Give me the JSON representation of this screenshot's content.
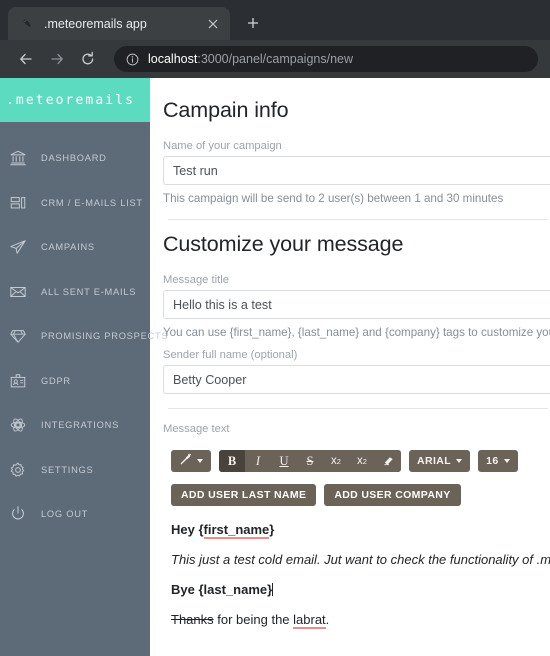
{
  "browser": {
    "tab": {
      "title": ".meteoremails app",
      "favicon_icon": "rocket-icon",
      "close_icon": "close-icon"
    },
    "new_tab_label": "+",
    "back_icon": "back-arrow-icon",
    "forward_icon": "forward-arrow-icon",
    "reload_icon": "reload-icon",
    "site_info_icon": "info-circle-icon",
    "url_host": "localhost",
    "url_path": ":3000/panel/campaigns/new"
  },
  "sidebar": {
    "brand": ".meteoremails",
    "brand_color": "#5cdbc0",
    "bg_color": "#5d6b78",
    "items": [
      {
        "label": "DASHBOARD",
        "icon": "bank-icon"
      },
      {
        "label": "CRM / E-MAILS LIST",
        "icon": "list-icon"
      },
      {
        "label": "CAMPAINS",
        "icon": "paper-plane-icon"
      },
      {
        "label": "ALL SENT E-MAILS",
        "icon": "envelope-icon"
      },
      {
        "label": "PROMISING PROSPECTS",
        "icon": "diamond-icon"
      },
      {
        "label": "GDPR",
        "icon": "id-card-icon"
      },
      {
        "label": "INTEGRATIONS",
        "icon": "atom-icon"
      },
      {
        "label": "SETTINGS",
        "icon": "gear-icon"
      },
      {
        "label": "LOG OUT",
        "icon": "power-icon"
      }
    ]
  },
  "main": {
    "campaign_section": {
      "heading": "Campain info",
      "name_label": "Name of your campaign",
      "name_value": "Test run",
      "name_placeholder": "Name of your campaign",
      "help": "This campaign will be send to 2 user(s) between 1 and 30 minutes"
    },
    "message_section": {
      "heading": "Customize your message",
      "title_label": "Message title",
      "title_value": "Hello this is a test",
      "title_placeholder": "Message title",
      "title_help": "You can use {first_name}, {last_name} and {company} tags to customize your messag",
      "sender_label": "Sender full name (optional)",
      "sender_value": "Betty Cooper",
      "sender_placeholder": "Sender full name",
      "text_label": "Message text"
    },
    "toolbar": {
      "magic_icon": "magic-wand-icon",
      "bold_label": "B",
      "italic_label": "I",
      "underline_label": "U",
      "strike_label": "S",
      "superscript_label": "x",
      "superscript_sup": "2",
      "subscript_label": "x",
      "subscript_sub": "2",
      "eraser_icon": "eraser-icon",
      "font_family": "ARIAL",
      "font_size": "16",
      "button_color": "#6b6258",
      "active_color": "#4a433c"
    },
    "tag_buttons": [
      {
        "label": "ADD USER LAST NAME"
      },
      {
        "label": "ADD USER COMPANY"
      }
    ],
    "body": {
      "line1_prefix": "Hey {",
      "line1_tag": "first_name",
      "line1_suffix": "}",
      "line2": "This just a test cold email. Jut want to check the functionality of .meteor",
      "line3": "Bye {last_name}",
      "line4_strike": "Thanks",
      "line4_mid": " for being the ",
      "line4_spell": "labrat",
      "line4_end": "."
    }
  }
}
